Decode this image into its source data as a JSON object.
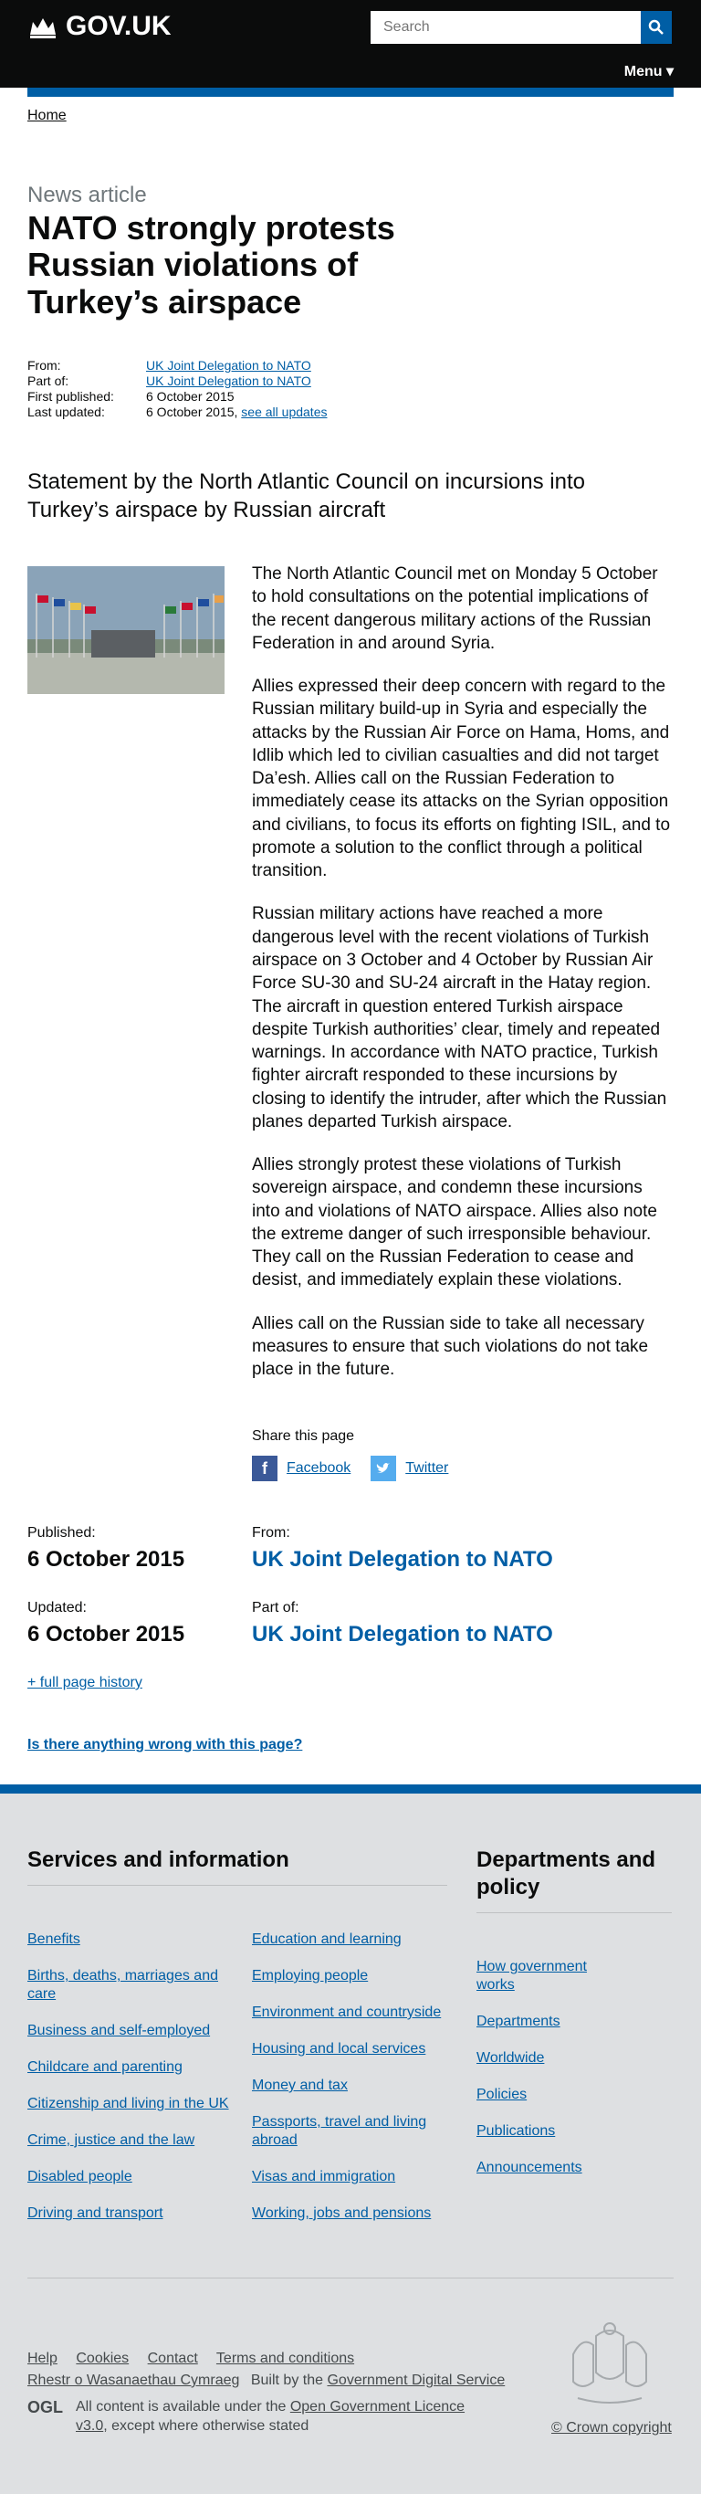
{
  "header": {
    "logo_text": "GOV.UK",
    "search_placeholder": "Search",
    "menu_label": "Menu ▾"
  },
  "breadcrumb": {
    "home": "Home"
  },
  "article": {
    "doc_type": "News article",
    "title": "NATO strongly protests Russian violations of Turkey’s airspace",
    "meta": {
      "from_label": "From:",
      "from_value": "UK Joint Delegation to NATO",
      "part_of_label": "Part of:",
      "part_of_value": "UK Joint Delegation to NATO",
      "first_published_label": "First published:",
      "first_published_value": "6 October 2015",
      "last_updated_label": "Last updated:",
      "last_updated_value": "6 October 2015,",
      "see_all_updates": "see all updates"
    },
    "summary": "Statement by the North Atlantic Council on incursions into Turkey’s airspace by Russian aircraft",
    "paragraphs": [
      "The North Atlantic Council met on Monday 5 October to hold consultations on the potential implications of the recent dangerous military actions of the Russian Federation in and around Syria.",
      "Allies expressed their deep concern with regard to the Russian military build-up in Syria and especially the attacks by the Russian Air Force on Hama, Homs, and Idlib which led to civilian casualties and did not target Da’esh. Allies call on the Russian Federation to immediately cease its attacks on the Syrian opposition and civilians, to focus its efforts on fighting ISIL, and to promote a solution to the conflict through a political transition.",
      "Russian military actions have reached a more dangerous level with the recent violations of Turkish airspace on 3 October and 4 October by Russian Air Force SU-30 and SU-24 aircraft in the Hatay region. The aircraft in question entered Turkish airspace despite Turkish authorities’ clear, timely and repeated warnings. In accordance with NATO practice, Turkish fighter aircraft responded to these incursions by closing to identify the intruder, after which the Russian planes departed Turkish airspace.",
      "Allies strongly protest these violations of Turkish sovereign airspace, and condemn these incursions into and violations of NATO airspace. Allies also note the extreme danger of such irresponsible behaviour. They call on the Russian Federation to cease and desist, and immediately explain these violations.",
      "Allies call on the Russian side to take all necessary measures to ensure that such violations do not take place in the future."
    ]
  },
  "share": {
    "label": "Share this page",
    "facebook": "Facebook",
    "twitter": "Twitter"
  },
  "publication": {
    "published_label": "Published:",
    "published_value": "6 October 2015",
    "from_label": "From:",
    "from_value": "UK Joint Delegation to NATO",
    "updated_label": "Updated:",
    "updated_value": "6 October 2015",
    "part_of_label": "Part of:",
    "part_of_value": "UK Joint Delegation to NATO",
    "history_link": "+ full page history"
  },
  "feedback": {
    "text": "Is there anything wrong with this page?"
  },
  "footer": {
    "services_title": "Services and information",
    "services_col1": [
      "Benefits",
      "Births, deaths, marriages and care",
      "Business and self-employed",
      "Childcare and parenting",
      "Citizenship and living in the UK",
      "Crime, justice and the law",
      "Disabled people",
      "Driving and transport"
    ],
    "services_col2": [
      "Education and learning",
      "Employing people",
      "Environment and countryside",
      "Housing and local services",
      "Money and tax",
      "Passports, travel and living abroad",
      "Visas and immigration",
      "Working, jobs and pensions"
    ],
    "departments_title": "Departments and policy",
    "departments": [
      "How government works",
      "Departments",
      "Worldwide",
      "Policies",
      "Publications",
      "Announcements"
    ],
    "links": {
      "help": "Help",
      "cookies": "Cookies",
      "contact": "Contact",
      "terms": "Terms and conditions",
      "welsh": "Rhestr o Wasanaethau Cymraeg",
      "built_by_prefix": "Built by the",
      "built_by_link": "Government Digital Service"
    },
    "licence": {
      "ogl": "OGL",
      "prefix": "All content is available under the",
      "link": "Open Government Licence v3.0",
      "suffix": ", except where otherwise stated"
    },
    "copyright": "© Crown copyright"
  },
  "colors": {
    "header_bg": "#0b0c0c",
    "link": "#005ea5",
    "footer_bg": "#dee0e2",
    "facebook": "#3b5998",
    "twitter": "#55acee"
  }
}
